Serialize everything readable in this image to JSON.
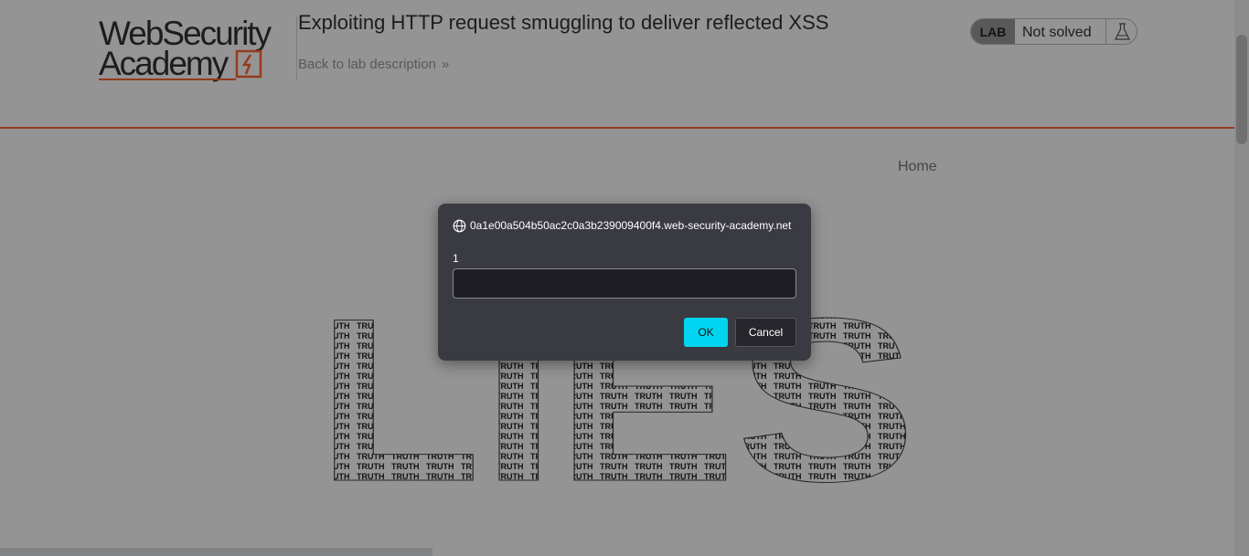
{
  "header": {
    "logo_line1": "WebSecurity",
    "logo_line2": "Academy",
    "lab_title": "Exploiting HTTP request smuggling to deliver reflected XSS",
    "back_link": "Back to lab description",
    "status_badge": "LAB",
    "status_text": "Not solved"
  },
  "nav": {
    "home": "Home"
  },
  "hero": {
    "big_word": "LIES",
    "fill_word": "TRUTH"
  },
  "dialog": {
    "origin": "0a1e00a504b50ac2c0a3b239009400f4.web-security-academy.net",
    "message": "1",
    "input_value": "",
    "ok_label": "OK",
    "cancel_label": "Cancel"
  },
  "colors": {
    "accent_orange": "#ff6633",
    "ok_button": "#00d4f0",
    "dialog_bg": "#3a3a43"
  }
}
